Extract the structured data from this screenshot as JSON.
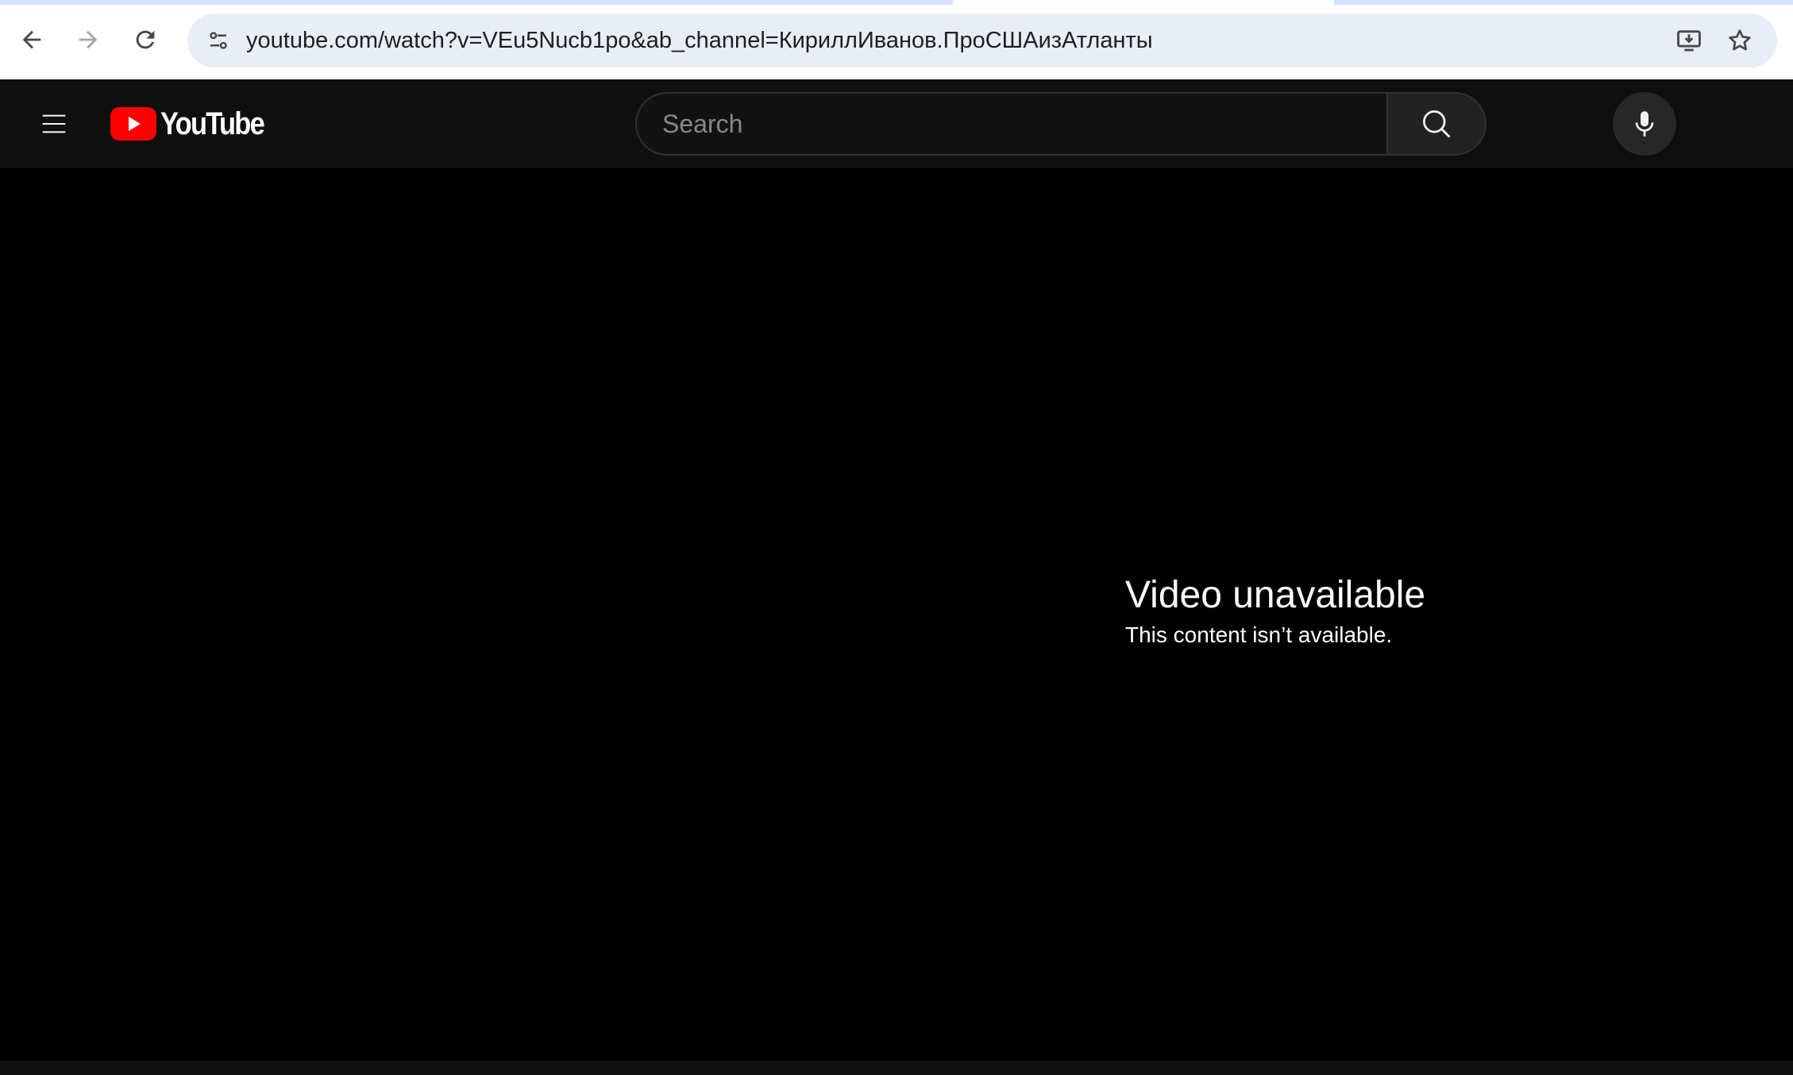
{
  "browser": {
    "url": "youtube.com/watch?v=VEu5Nucb1po&ab_channel=КириллИванов.ПроСШАизАтланты",
    "icons": {
      "back": "arrow-left-icon",
      "forward": "arrow-right-icon",
      "reload": "reload-icon",
      "site_info": "tune-icon",
      "install": "install-app-icon",
      "bookmark": "star-icon"
    }
  },
  "masthead": {
    "logo_text": "YouTube",
    "search_placeholder": "Search",
    "icons": {
      "menu": "hamburger-menu-icon",
      "search": "search-icon",
      "voice": "microphone-icon"
    },
    "colors": {
      "background": "#0f0f0f",
      "logo_red": "#ff0000"
    }
  },
  "player": {
    "title": "Video unavailable",
    "subtitle": "This content isn’t available."
  }
}
